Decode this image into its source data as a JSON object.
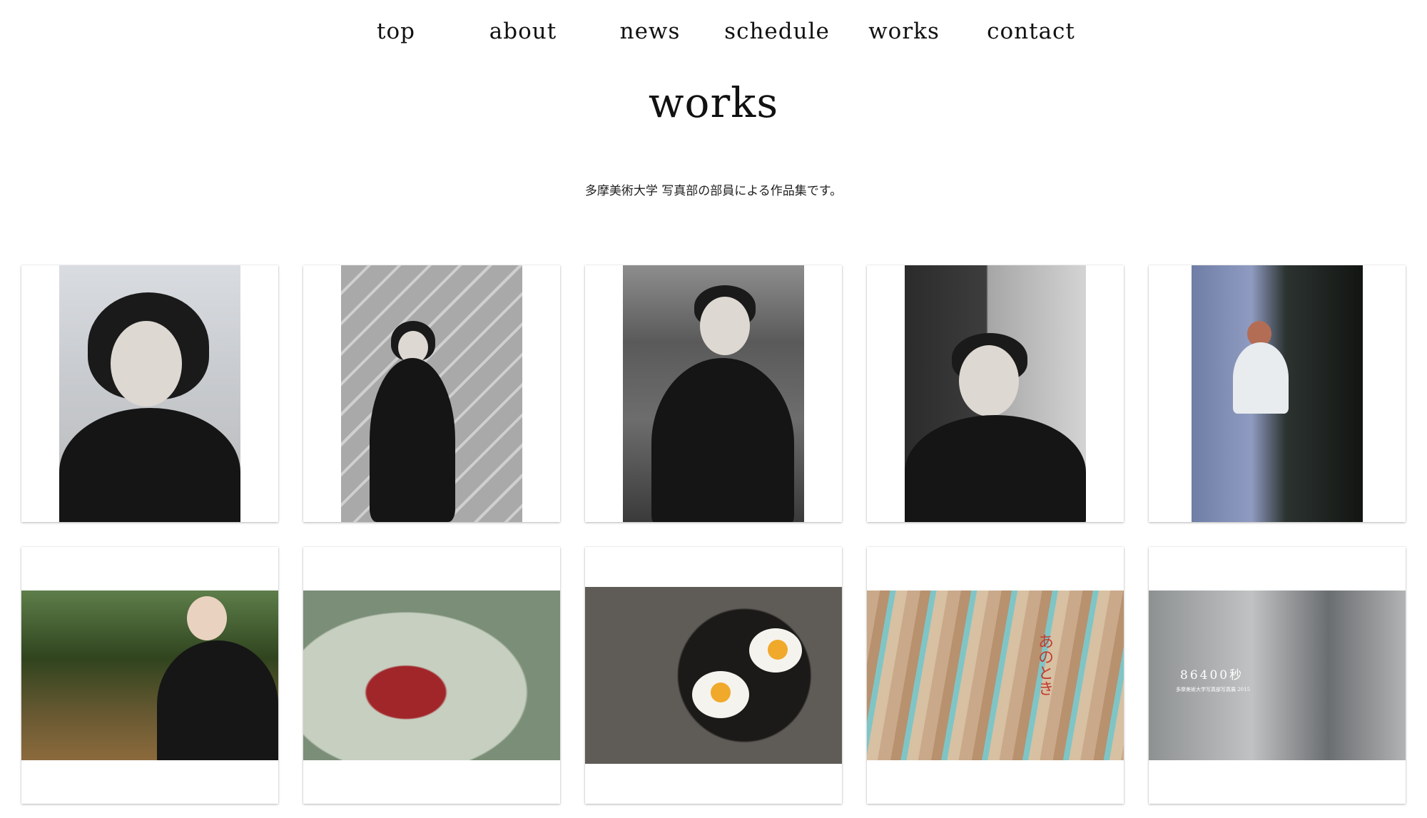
{
  "nav": {
    "items": [
      "top",
      "about",
      "news",
      "schedule",
      "works",
      "contact"
    ]
  },
  "page": {
    "title": "works",
    "subtitle": "多摩美術大学 写真部の部員による作品集です。"
  },
  "gallery": {
    "overlays": {
      "card9_vertical": "あのとき",
      "card10_title": "86400秒",
      "card10_caption": "多摩美術大学写真部写真展 2015"
    }
  },
  "colors": {
    "background": "#ffffff",
    "text": "#111111"
  }
}
